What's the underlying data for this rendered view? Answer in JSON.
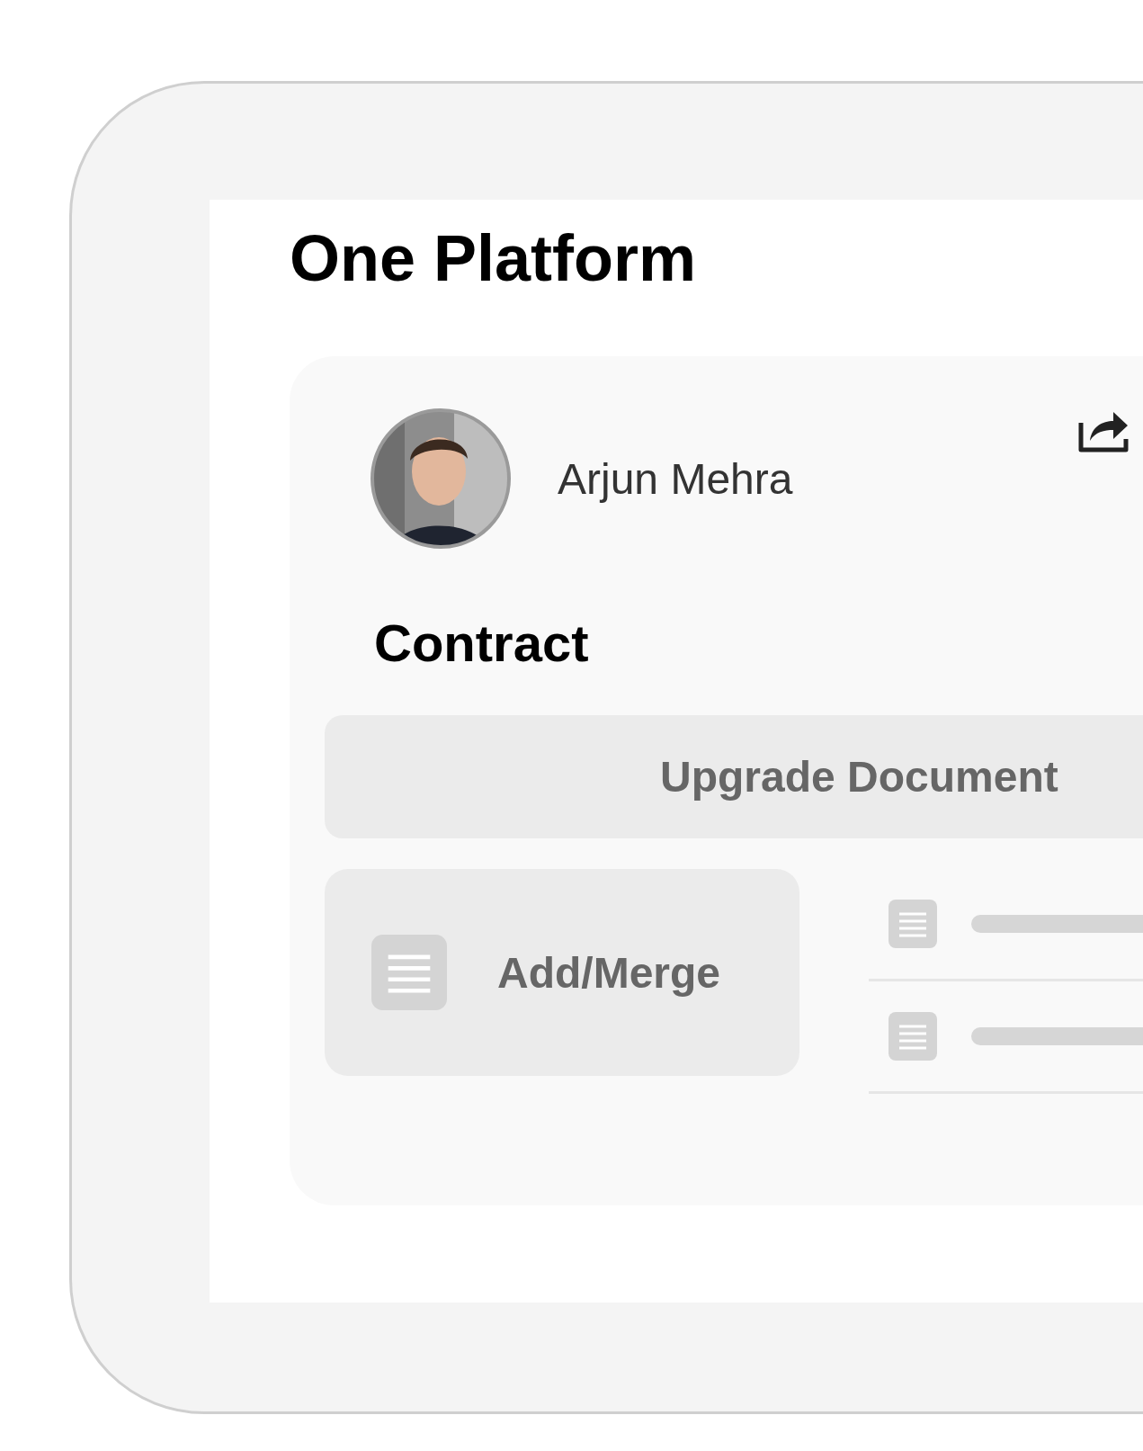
{
  "title": "One Platform",
  "profile": {
    "name": "Arjun Mehra"
  },
  "section_title": "Contract",
  "upgrade_button": {
    "label": "Upgrade Document"
  },
  "add_merge_button": {
    "label": "Add/Merge"
  },
  "documents": [
    {
      "kind": "skeleton"
    },
    {
      "kind": "skeleton"
    }
  ]
}
